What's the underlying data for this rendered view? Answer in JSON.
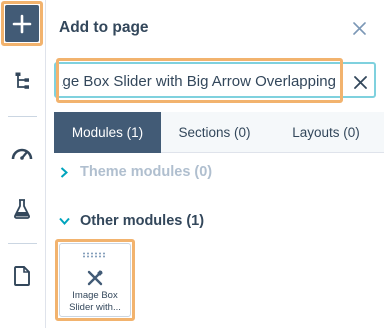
{
  "sidebar": {
    "items": [
      {
        "name": "add",
        "icon": "plus-icon"
      },
      {
        "name": "layers",
        "icon": "tree-icon"
      },
      {
        "name": "optimize",
        "icon": "gauge-icon"
      },
      {
        "name": "test",
        "icon": "flask-icon"
      },
      {
        "name": "page-settings",
        "icon": "document-icon"
      }
    ]
  },
  "panel": {
    "title": "Add to page",
    "close_icon": "close-icon"
  },
  "search": {
    "value": "Image Box Slider with Big Arrow Overlapping"
  },
  "tabs": [
    {
      "label": "Modules (1)",
      "active": true
    },
    {
      "label": "Sections (0)",
      "active": false
    },
    {
      "label": "Layouts (0)",
      "active": false
    }
  ],
  "sections": {
    "theme": {
      "label": "Theme modules (0)",
      "expanded": false
    },
    "other": {
      "label": "Other modules (1)",
      "expanded": true
    }
  },
  "modules": [
    {
      "name_line1": "Image Box",
      "name_line2": "Slider with...",
      "icon": "tools-icon"
    }
  ],
  "colors": {
    "accent": "#425b76",
    "highlight": "#f2b36e",
    "focus": "#7fd1de",
    "teal": "#00a4bd"
  }
}
